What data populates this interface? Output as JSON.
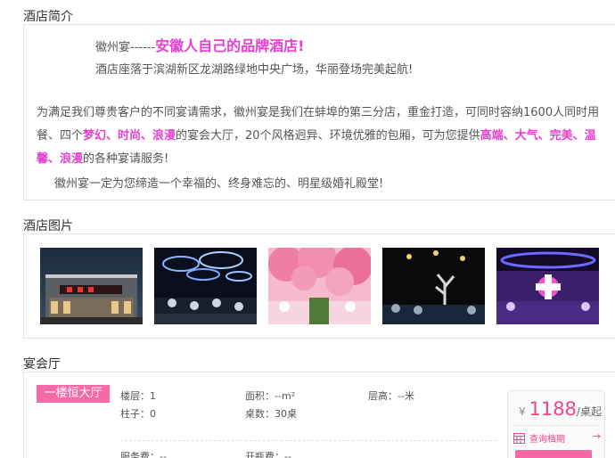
{
  "intro": {
    "title": "酒店简介",
    "slogan_prefix": "徽州宴------",
    "slogan": "安徽人自己的品牌酒店!",
    "line2": "酒店座落于滨湖新区龙湖路绿地中央广场，华丽登场完美起航!",
    "para1_a": "为满足我们尊贵客户的不同宴请需求，徽州宴是我们在蚌埠的第三分店，重金打造，可同时容纳1600人同时用",
    "para1_b1": "餐、四个",
    "para1_hl1": "梦幻、时尚、浪漫",
    "para1_b2": "的宴会大厅，20个风格迥异、环境优雅的包厢，可为您提供",
    "para1_hl2": "高端、大气、完美、温",
    "para1_hl3": "馨、浪漫",
    "para1_c": "的各种宴请服务!",
    "para2": "徽州宴一定为您缔造一个幸福的、终身难忘的、明星级婚礼殿堂!"
  },
  "photos": {
    "title": "酒店图片"
  },
  "banquet": {
    "title": "宴会厅",
    "hall_name": "一楼恒大厅",
    "floor": "楼层：1",
    "area": "面积：--m²",
    "height": "层高：--米",
    "pillars": "柱子：0",
    "tables": "桌数：30桌",
    "service_fee": "服务费：--",
    "corkage": "开瓶费：--",
    "currency": "¥",
    "price": "1188",
    "price_unit": "/桌起",
    "check_label": "查询档期"
  },
  "colors": {
    "accent": "#e83ed1",
    "pink": "#f56aa6",
    "price": "#f0448e"
  }
}
